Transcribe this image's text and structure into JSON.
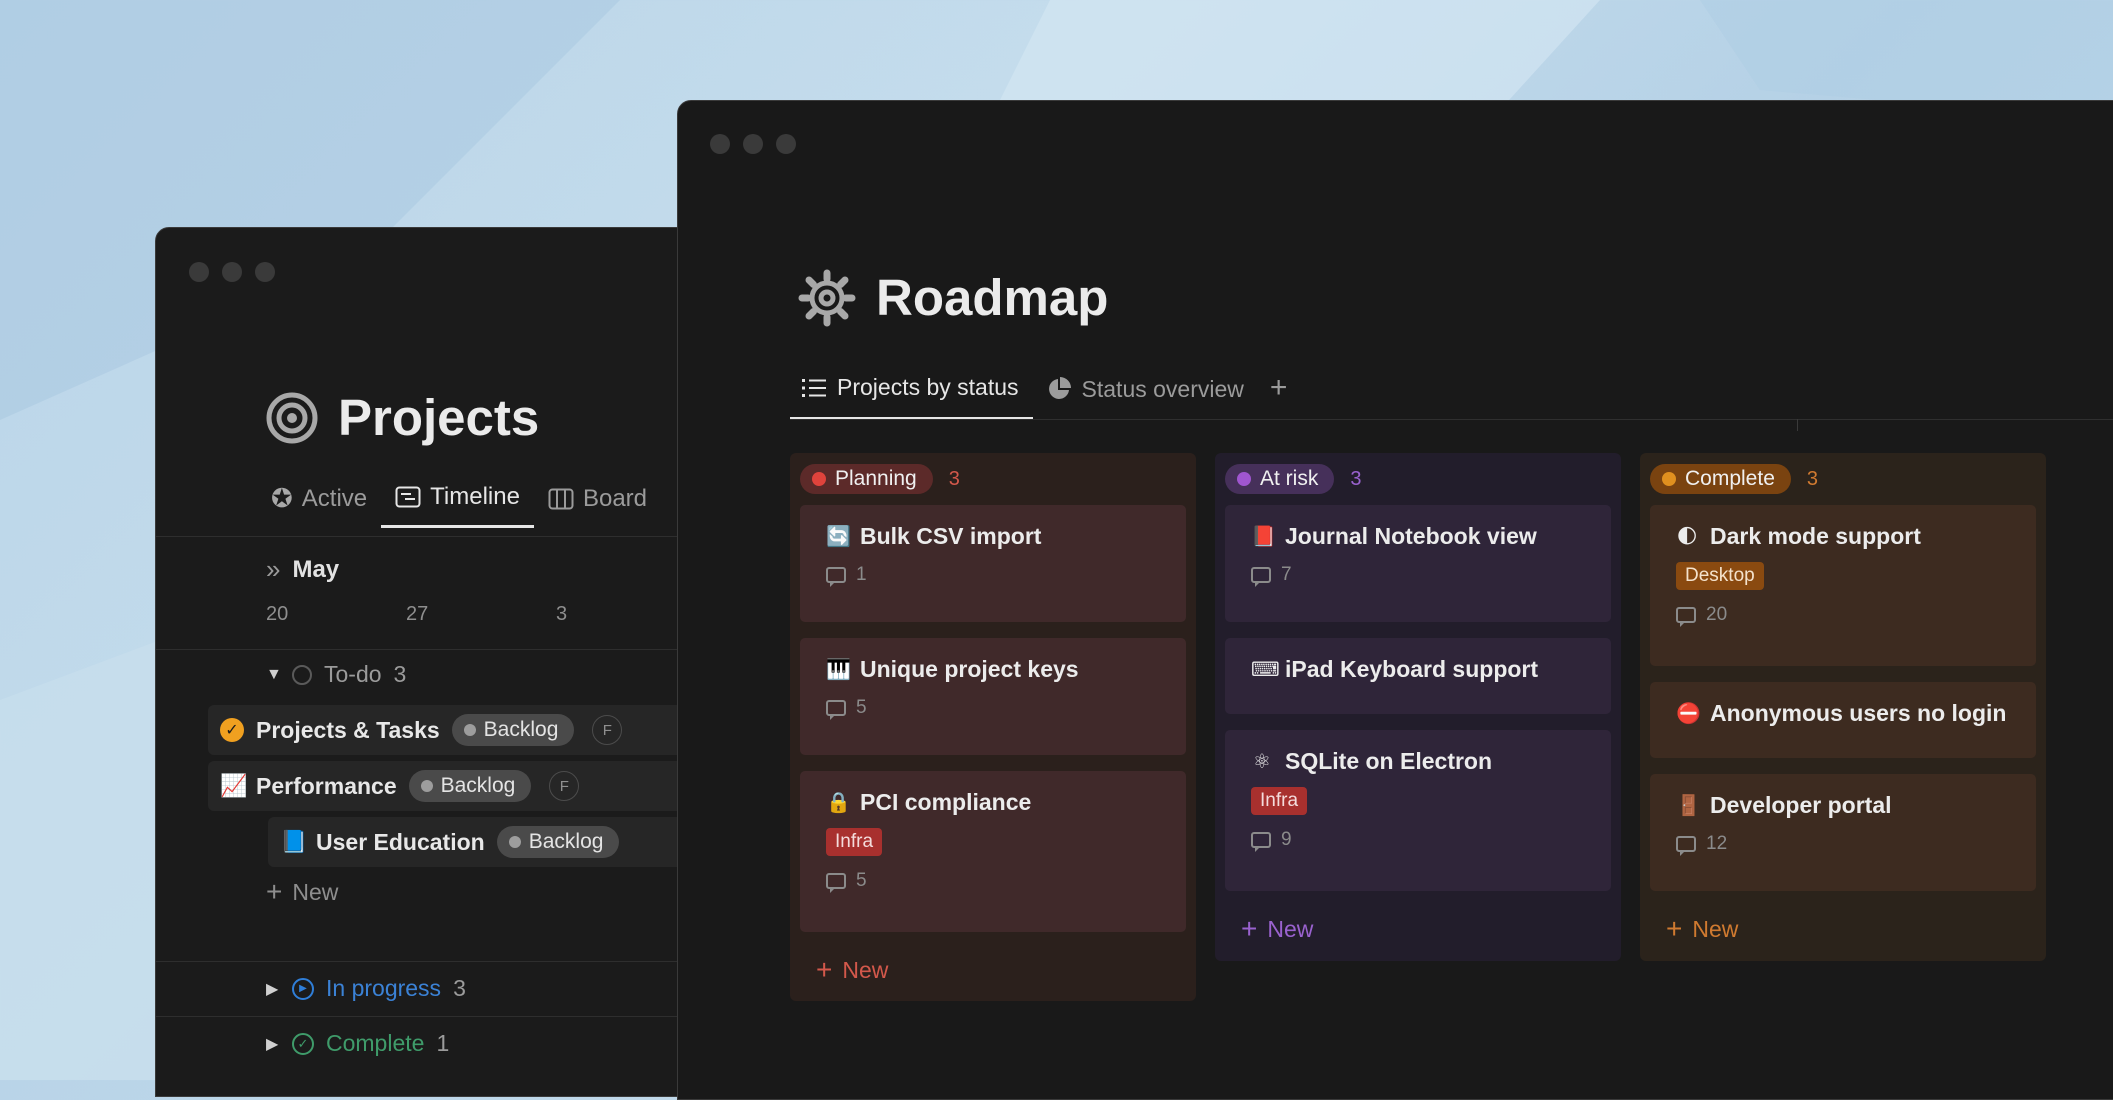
{
  "projects": {
    "title": "Projects",
    "tabs": [
      {
        "label": "Active",
        "icon": "star-icon"
      },
      {
        "label": "Timeline",
        "icon": "timeline-icon"
      },
      {
        "label": "Board",
        "icon": "board-icon"
      }
    ],
    "month": "May",
    "dates": [
      "20",
      "27",
      "3"
    ],
    "groups": {
      "todo": {
        "label": "To-do",
        "count": "3"
      },
      "in_progress": {
        "label": "In progress",
        "count": "3"
      },
      "complete": {
        "label": "Complete",
        "count": "1"
      }
    },
    "rows": [
      {
        "label": "Projects & Tasks",
        "status": "Backlog",
        "avatar": "F",
        "icon": "check-circle-icon"
      },
      {
        "label": "Performance",
        "status": "Backlog",
        "avatar": "F",
        "icon": "chart-up-icon"
      },
      {
        "label": "User Education",
        "status": "Backlog",
        "avatar": "",
        "icon": "book-icon"
      }
    ],
    "new_label": "New"
  },
  "roadmap": {
    "title": "Roadmap",
    "tabs": [
      {
        "label": "Projects by status",
        "icon": "list-icon"
      },
      {
        "label": "Status overview",
        "icon": "pie-chart-icon"
      }
    ],
    "new_label": "New",
    "columns": [
      {
        "status": "Planning",
        "count": "3",
        "colors": {
          "bg": "#2b201c",
          "card": "#40292a",
          "badge": "#5c2a29",
          "dot": "#e0433c",
          "accent": "#d3584b"
        },
        "cards": [
          {
            "emoji": "🔄",
            "title": "Bulk CSV import",
            "tag": "",
            "comments": "1"
          },
          {
            "emoji": "🎹",
            "title": "Unique project keys",
            "tag": "",
            "comments": "5"
          },
          {
            "emoji": "🔒",
            "title": "PCI compliance",
            "tag": "Infra",
            "comments": "5"
          }
        ]
      },
      {
        "status": "At risk",
        "count": "3",
        "colors": {
          "bg": "#221d2b",
          "card": "#2f2539",
          "badge": "#46305a",
          "dot": "#a056d0",
          "accent": "#9a62cf"
        },
        "cards": [
          {
            "emoji": "📕",
            "title": "Journal Notebook view",
            "tag": "",
            "comments": "7"
          },
          {
            "emoji": "⌨",
            "title": "iPad Keyboard support",
            "tag": "",
            "comments": ""
          },
          {
            "emoji": "⚛",
            "title": "SQLite on Electron",
            "tag": "Infra",
            "comments": "9"
          }
        ]
      },
      {
        "status": "Complete",
        "count": "3",
        "colors": {
          "bg": "#2b231b",
          "card": "#3d2b20",
          "badge": "#7a4310",
          "dot": "#e0901f",
          "accent": "#d07a30"
        },
        "cards": [
          {
            "emoji": "🌓",
            "title": "Dark mode support",
            "tag": "Desktop",
            "comments": "20"
          },
          {
            "emoji": "⛔",
            "title": "Anonymous users no login",
            "tag": "",
            "comments": ""
          },
          {
            "emoji": "🚪",
            "title": "Developer portal",
            "tag": "",
            "comments": "12"
          }
        ]
      }
    ]
  }
}
